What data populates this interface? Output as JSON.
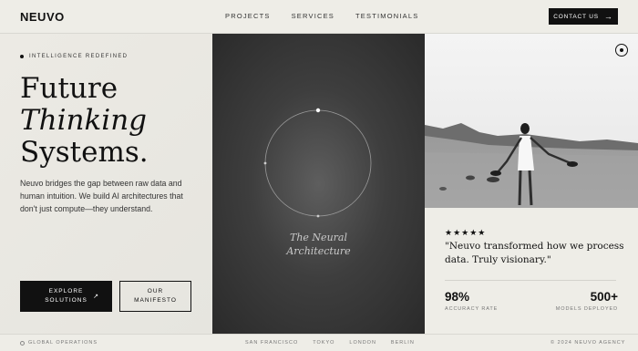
{
  "header": {
    "logo": "NEUVO",
    "nav": [
      "PROJECTS",
      "SERVICES",
      "TESTIMONIALS"
    ],
    "contact_label": "CONTACT US",
    "contact_icon": "arrow-right-icon"
  },
  "hero": {
    "eyebrow": "INTELLIGENCE REDEFINED",
    "headline": [
      "Future",
      "Thinking",
      "Systems."
    ],
    "description": "Neuvo bridges the gap between raw data and human intuition. We build AI architectures that don't just compute—they understand.",
    "explore_button": [
      "EXPLORE",
      "SOLUTIONS"
    ],
    "manifesto_button": [
      "OUR",
      "MANIFESTO"
    ]
  },
  "neural": {
    "caption": [
      "The Neural",
      "Architecture"
    ]
  },
  "testimonial": {
    "stars": "★★★★★",
    "rating": 5,
    "quote": "\"Neuvo transformed how we process data. Truly visionary.\"",
    "stats": [
      {
        "value": "98%",
        "label": "ACCURACY RATE"
      },
      {
        "value": "500+",
        "label": "MODELS DEPLOYED"
      }
    ]
  },
  "footer": {
    "operations": "GLOBAL OPERATIONS",
    "cities": [
      "SAN FRANCISCO",
      "TOKYO",
      "LONDON",
      "BERLIN"
    ],
    "copyright": "© 2024 NEUVO AGENCY"
  },
  "colors": {
    "background": "#eeede7",
    "ink": "#111111",
    "panel_dark": "#3e3e3e"
  }
}
